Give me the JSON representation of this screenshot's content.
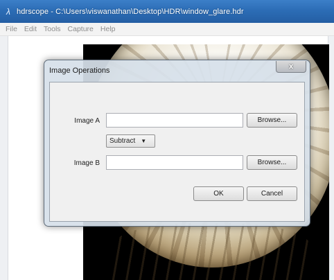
{
  "window": {
    "title": "hdrscope - C:\\Users\\viswanathan\\Desktop\\HDR\\window_glare.hdr",
    "app_icon_glyph": "λ"
  },
  "menu": {
    "items": [
      "File",
      "Edit",
      "Tools",
      "Capture",
      "Help"
    ]
  },
  "dialog": {
    "title": "Image Operations",
    "close_glyph": "x",
    "image_a_label": "Image A",
    "image_a_value": "",
    "image_b_label": "Image B",
    "image_b_value": "",
    "browse_label": "Browse...",
    "operation_selected": "Subtract",
    "caret_glyph": "▼",
    "ok_label": "OK",
    "cancel_label": "Cancel"
  },
  "colors": {
    "titlebar": "#2c6db6",
    "menu_text": "#8c8c8c",
    "dialog_frame": "#d6e0ea"
  }
}
